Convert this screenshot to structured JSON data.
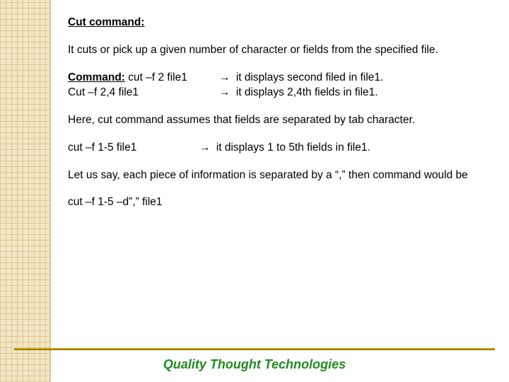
{
  "title": "Cut command:",
  "intro": "It cuts or pick up a given number of character or fields from the specified file.",
  "command_label": "Command:",
  "arrow": "→",
  "examples": [
    {
      "cmd": "cut –f 2 file1",
      "desc": "it displays second filed in file1."
    },
    {
      "cmd": "Cut –f 2,4 file1",
      "desc": "it displays 2,4th fields in file1."
    }
  ],
  "assume": "Here, cut command assumes that fields are separated by tab character.",
  "range_example": {
    "cmd": "cut –f 1-5 file1",
    "desc": "it displays 1 to 5th fields in file1."
  },
  "delim_intro": "Let us say, each piece of information is separated by a “,” then command would be",
  "delim_cmd": "cut –f 1-5 –d”,” file1",
  "footer": "Quality Thought Technologies"
}
